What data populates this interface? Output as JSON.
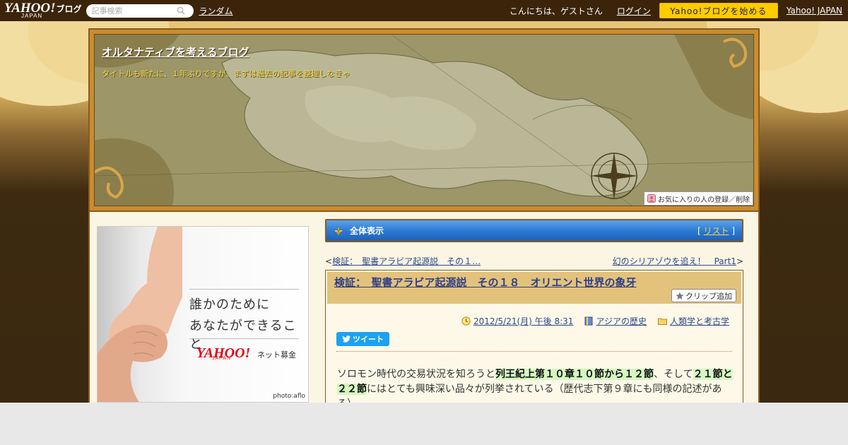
{
  "topbar": {
    "logo_text": "YAHOO!",
    "logo_sub": "JAPAN",
    "logo_blog": "ブログ",
    "search_placeholder": "記事検索",
    "random_label": "ランダム",
    "greeting": "こんにちは、ゲストさん",
    "login_label": "ログイン",
    "start_blog_label": "Yahoo!ブログを始める",
    "yahoo_japan_label": "Yahoo! JAPAN"
  },
  "header": {
    "blog_title": "オルタナティブを考えるブログ",
    "blog_subtitle": "タイトルも新たに、１年ぶりですが、まずは過去の記事を整理しなきゃ",
    "favorite_label": "お気に入りの人の登録／削除"
  },
  "ad": {
    "line1": "誰かのために",
    "line2": "あなたができること",
    "brand": "YAHOO!",
    "brand_sub": "JAPAN",
    "donation": "ネット募金",
    "credit": "photo:aflo"
  },
  "view_bar": {
    "label": "全体表示",
    "list_open": "[",
    "list_label": "リスト",
    "list_close": "]"
  },
  "nav": {
    "prev_mark": "<",
    "prev_label": "検証：　聖書アラビア起源説　その１…",
    "next_label": "幻のシリアゾウを追え！　Part1",
    "next_mark": ">"
  },
  "article": {
    "title": "検証：　聖書アラビア起源説　その１８　オリエント世界の象牙",
    "clip_label": "クリップ追加",
    "date": "2012/5/21(月) 午後 8:31",
    "category": "アジアの歴史",
    "folder": "人類学と考古学",
    "tweet_label": "ツイート",
    "body_part1": "ソロモン時代の交易状況を知ろうと",
    "body_hl1": "列王紀上第１０章１０節から１２節",
    "body_part2": "、そして",
    "body_hl2": "２１節と２２節",
    "body_part3": "にはとても興味深い品々が列挙されている（歴代志下第９章にも同様の記述がある）"
  },
  "colors": {
    "topbar_bg": "#3b2409",
    "start_button": "#ffcc00",
    "view_bar_blue": "#2d7ad3",
    "title_link": "#2c3f8a",
    "highlight": "#d5f7c2"
  }
}
